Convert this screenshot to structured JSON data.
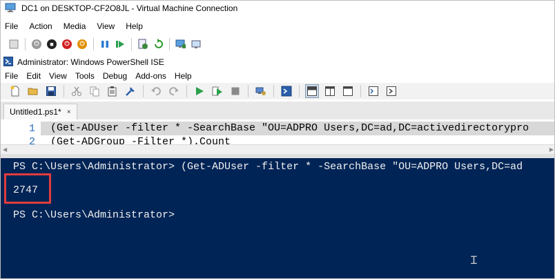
{
  "vm_window": {
    "title": "DC1 on DESKTOP-CF2O8JL - Virtual Machine Connection",
    "menu": [
      "File",
      "Action",
      "Media",
      "View",
      "Help"
    ]
  },
  "ise_window": {
    "title": "Administrator: Windows PowerShell ISE",
    "menu": [
      "File",
      "Edit",
      "View",
      "Tools",
      "Debug",
      "Add-ons",
      "Help"
    ]
  },
  "tab": {
    "label": "Untitled1.ps1*",
    "close": "×"
  },
  "script": {
    "lines": [
      {
        "number": "1",
        "text": "(Get-ADUser -filter * -SearchBase \"OU=ADPRO Users,DC=ad,DC=activedirectorypro"
      },
      {
        "number": "2",
        "text": "(Get-ADGroup -Filter *).Count"
      }
    ]
  },
  "console": {
    "prompt_command": "PS C:\\Users\\Administrator> (Get-ADUser -filter * -SearchBase \"OU=ADPRO Users,DC=ad",
    "result": "2747",
    "prompt": "PS C:\\Users\\Administrator>"
  },
  "colors": {
    "console_bg": "#012456",
    "highlight_border": "#e23c3c",
    "line_number": "#2b6fb6"
  }
}
